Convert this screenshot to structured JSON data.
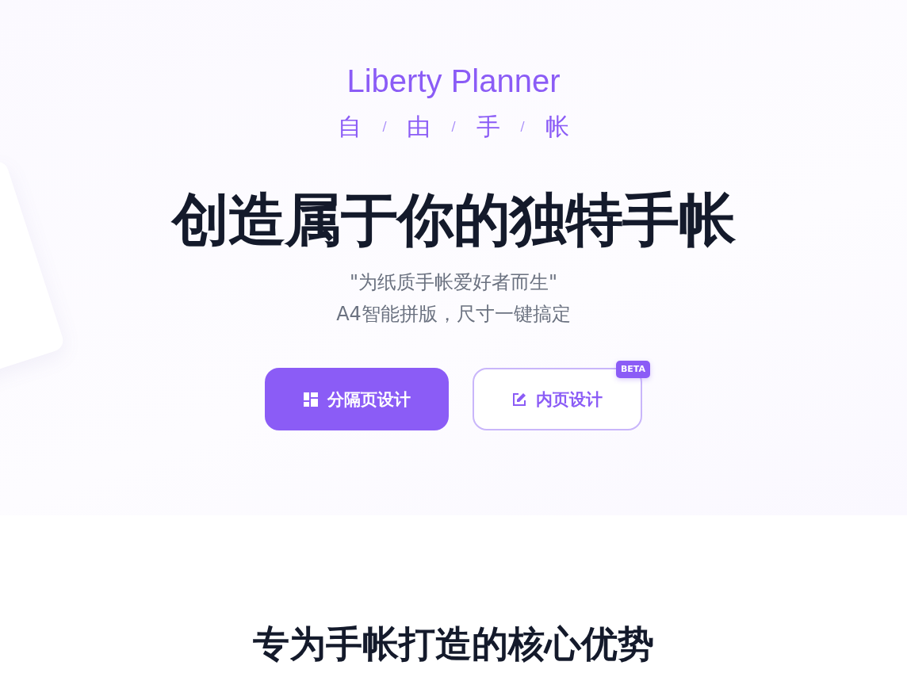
{
  "hero": {
    "brand": "Liberty Planner",
    "subtitle": [
      {
        "kind": "char",
        "text": "自"
      },
      {
        "kind": "separator",
        "text": "/"
      },
      {
        "kind": "char",
        "text": "由"
      },
      {
        "kind": "separator",
        "text": "/"
      },
      {
        "kind": "char",
        "text": "手"
      },
      {
        "kind": "separator",
        "text": "/"
      },
      {
        "kind": "char",
        "text": "帐"
      }
    ],
    "headline": "创造属于你的独特手帐",
    "tagline": [
      "\"为纸质手帐爱好者而生\"",
      "A4智能拼版，尺寸一键搞定"
    ],
    "buttons": [
      {
        "kind": "primary",
        "label": "分隔页设计"
      },
      {
        "kind": "outline",
        "label": "内页设计",
        "badge": "BETA"
      }
    ]
  },
  "features": {
    "title": "专为手帐打造的核心优势"
  }
}
